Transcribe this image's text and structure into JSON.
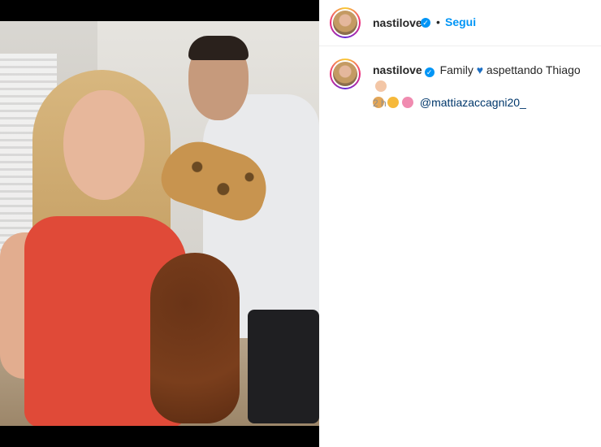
{
  "post": {
    "username": "nastilove",
    "follow_label": "Segui",
    "separator": "•",
    "caption": {
      "username": "nastilove",
      "text_before_heart": "Family",
      "text_after_heart": "aspettando Thiago",
      "mention": "@mattiazaccagni20_",
      "emojis": [
        "baby-emoji",
        "dog-face-emoji",
        "cat-face-emoji",
        "heart-hands-emoji"
      ]
    },
    "timestamp": "2 h"
  },
  "colors": {
    "verified": "#0095f6",
    "follow": "#0095f6",
    "mention": "#00376b",
    "heart": "#1c6fc4",
    "muted": "#8e8e8e"
  },
  "icons": {
    "verified": "verified-badge-icon",
    "heart": "blue-heart-icon"
  }
}
